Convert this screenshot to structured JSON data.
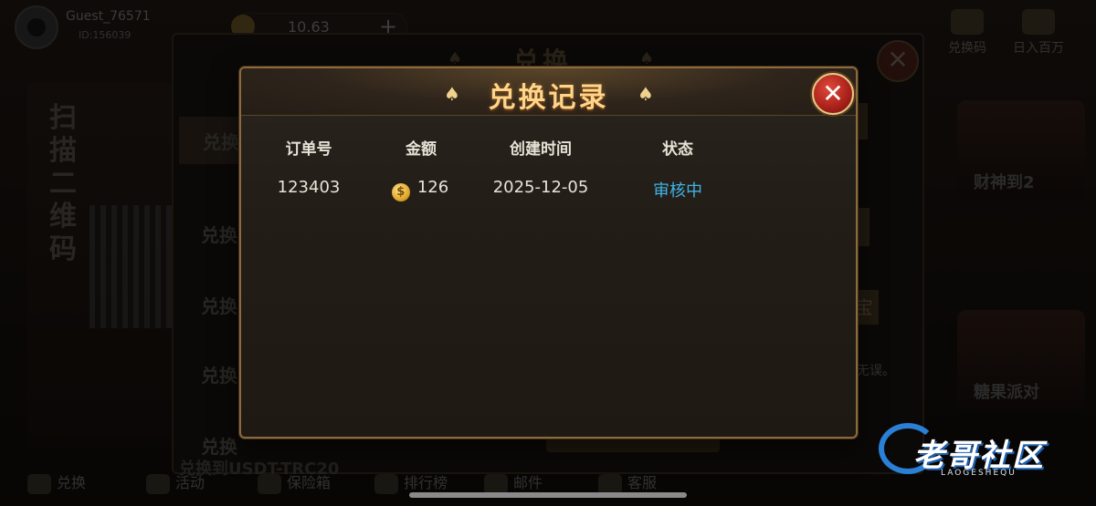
{
  "background": {
    "user": {
      "name": "Guest_76571",
      "id": "ID:156039"
    },
    "balance": {
      "value": "10.63",
      "plus": "+"
    },
    "right_menu": [
      {
        "label": "兑换码"
      },
      {
        "label": "日入百万"
      }
    ],
    "left_banner_text": "扫描二维码",
    "right_cards": [
      {
        "label": "财神到2"
      },
      {
        "label": "糖果派对"
      }
    ],
    "bottom_nav": [
      {
        "label": "兑换"
      },
      {
        "label": "活动"
      },
      {
        "label": "保险箱"
      },
      {
        "label": "排行榜"
      },
      {
        "label": "邮件"
      },
      {
        "label": "客服"
      }
    ]
  },
  "parent_dialog": {
    "title": "兑换",
    "close_glyph": "✕",
    "tabs": [
      {
        "label": "兑换"
      },
      {
        "label": "兑换"
      },
      {
        "label": "兑换"
      },
      {
        "label": "兑换"
      },
      {
        "label": "兑换"
      }
    ],
    "side_button": "宝",
    "hint": "无误。",
    "bottom_label": "兑换到USDT-TRC20"
  },
  "modal": {
    "title": "兑换记录",
    "spade_glyph": "♠",
    "close_glyph": "✕",
    "columns": {
      "order_no": "订单号",
      "amount": "金额",
      "created_at": "创建时间",
      "status": "状态"
    },
    "rows": [
      {
        "order_no": "123403",
        "coin_glyph": "$",
        "amount": "126",
        "created_at": "2025-12-05",
        "status": "审核中"
      }
    ],
    "colors": {
      "title": "#ffd58a",
      "status": "#3fb2e4",
      "border": "#8c6a3c"
    }
  },
  "watermark": {
    "text": "老哥社区",
    "sub": "LAOGESHEQU"
  }
}
